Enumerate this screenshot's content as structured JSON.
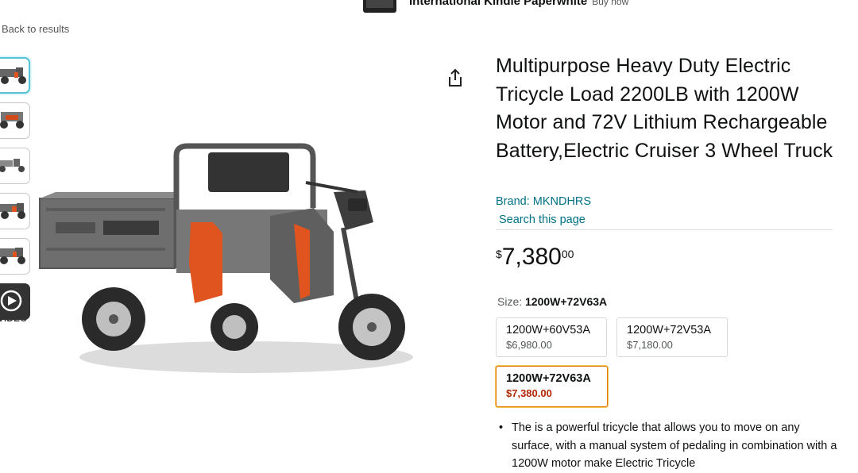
{
  "top_banner": {
    "title": "International Kindle Paperwhite",
    "subtitle": "Buy now"
  },
  "nav": {
    "back_link": "Back to results"
  },
  "gallery": {
    "video_label": "VIDEO",
    "thumbnail_count": 6
  },
  "product": {
    "title": "Multipurpose Heavy Duty Electric Tricycle Load 2200LB with 1200W Motor and 72V Lithium Rechargeable Battery,Electric Cruiser 3 Wheel Truck",
    "brand": "Brand: MKNDHRS",
    "search_link": "Search this page",
    "price": {
      "symbol": "$",
      "whole": "7,380",
      "fraction": "00"
    }
  },
  "size": {
    "label": "Size:",
    "selected": "1200W+72V63A",
    "options": [
      {
        "name": "1200W+60V53A",
        "price": "$6,980.00"
      },
      {
        "name": "1200W+72V53A",
        "price": "$7,180.00"
      },
      {
        "name": "1200W+72V63A",
        "price": "$7,380.00"
      }
    ]
  },
  "bullets": [
    "The is a powerful tricycle that allows you to move on any surface, with a manual system of pedaling in combination with a 1200W motor make Electric Tricycle"
  ],
  "colors": {
    "link": "#007185",
    "selected_border": "#e77600",
    "selected_price": "#b12704",
    "thumb_active": "#56c4d6"
  },
  "icons": [
    "kindle-icon",
    "share-icon",
    "play-icon"
  ]
}
